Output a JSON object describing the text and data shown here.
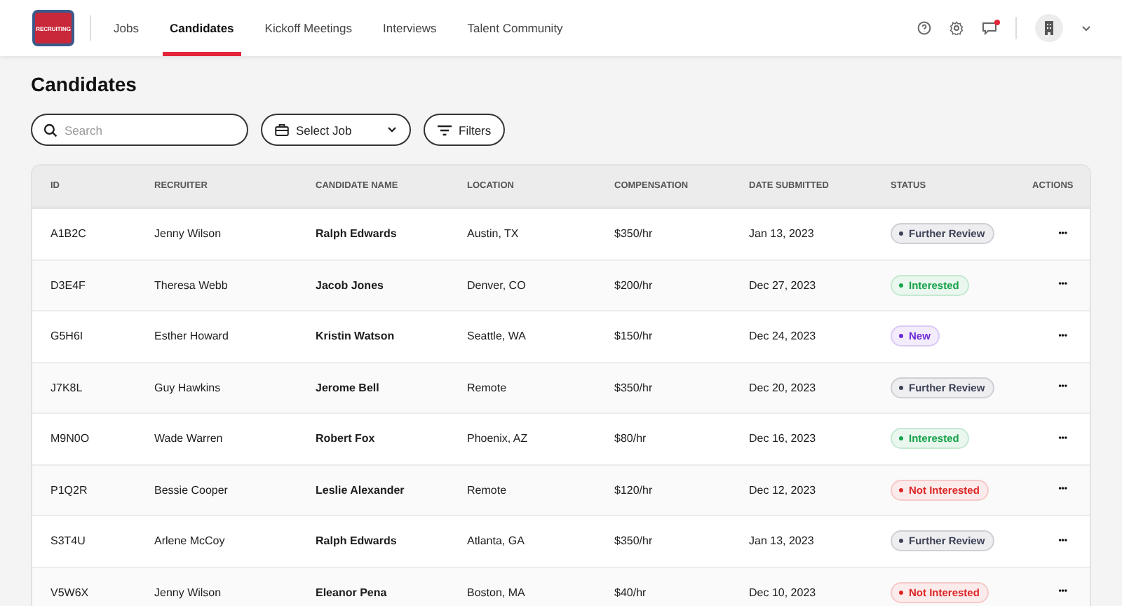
{
  "nav": {
    "logo_text": "RECRUITING",
    "tabs": [
      {
        "label": "Jobs",
        "selected": false
      },
      {
        "label": "Candidates",
        "selected": true
      },
      {
        "label": "Kickoff Meetings",
        "selected": false
      },
      {
        "label": "Interviews",
        "selected": false
      },
      {
        "label": "Talent Community",
        "selected": false
      }
    ],
    "notifications_unread": true
  },
  "page_title": "Candidates",
  "toolbar": {
    "search": {
      "placeholder": "Search"
    },
    "job_select": {
      "label": "Select Job"
    },
    "filters": {
      "label": "Filters"
    }
  },
  "table": {
    "columns": [
      "ID",
      "RECRUITER",
      "CANDIDATE NAME",
      "LOCATION",
      "COMPENSATION",
      "DATE SUBMITTED",
      "STATUS",
      "ACTIONS"
    ],
    "rows": [
      {
        "id": "A1B2C",
        "recruiter": "Jenny Wilson",
        "candidate": "Ralph Edwards",
        "location": "Austin, TX",
        "compensation": "$350/hr",
        "date": "Jan 13, 2023",
        "status": {
          "label": "Further Review",
          "color": "#3d4257"
        },
        "actions": "•••"
      },
      {
        "id": "D3E4F",
        "recruiter": "Theresa Webb",
        "candidate": "Jacob Jones",
        "location": "Denver, CO",
        "compensation": "$200/hr",
        "date": "Dec 27, 2023",
        "status": {
          "label": "Interested",
          "color": "#16a34a"
        },
        "actions": "•••"
      },
      {
        "id": "G5H6I",
        "recruiter": "Esther Howard",
        "candidate": "Kristin Watson",
        "location": "Seattle, WA",
        "compensation": "$150/hr",
        "date": "Dec 24, 2023",
        "status": {
          "label": "New",
          "color": "#6d28d9"
        },
        "actions": "•••"
      },
      {
        "id": "J7K8L",
        "recruiter": "Guy Hawkins",
        "candidate": "Jerome Bell",
        "location": "Remote",
        "compensation": "$350/hr",
        "date": "Dec 20, 2023",
        "status": {
          "label": "Further Review",
          "color": "#3d4257"
        },
        "actions": "•••"
      },
      {
        "id": "M9N0O",
        "recruiter": "Wade Warren",
        "candidate": "Robert Fox",
        "location": "Phoenix, AZ",
        "compensation": "$80/hr",
        "date": "Dec 16, 2023",
        "status": {
          "label": "Interested",
          "color": "#16a34a"
        },
        "actions": "•••"
      },
      {
        "id": "P1Q2R",
        "recruiter": "Bessie Cooper",
        "candidate": "Leslie Alexander",
        "location": "Remote",
        "compensation": "$120/hr",
        "date": "Dec 12, 2023",
        "status": {
          "label": "Not Interested",
          "color": "#dc2626"
        },
        "actions": "•••"
      },
      {
        "id": "S3T4U",
        "recruiter": "Arlene McCoy",
        "candidate": "Ralph Edwards",
        "location": "Atlanta, GA",
        "compensation": "$350/hr",
        "date": "Jan 13, 2023",
        "status": {
          "label": "Further Review",
          "color": "#3d4257"
        },
        "actions": "•••"
      },
      {
        "id": "V5W6X",
        "recruiter": "Jenny Wilson",
        "candidate": "Eleanor Pena",
        "location": "Boston, MA",
        "compensation": "$40/hr",
        "date": "Dec 10, 2023",
        "status": {
          "label": "Not Interested",
          "color": "#dc2626"
        },
        "actions": "•••"
      }
    ]
  }
}
